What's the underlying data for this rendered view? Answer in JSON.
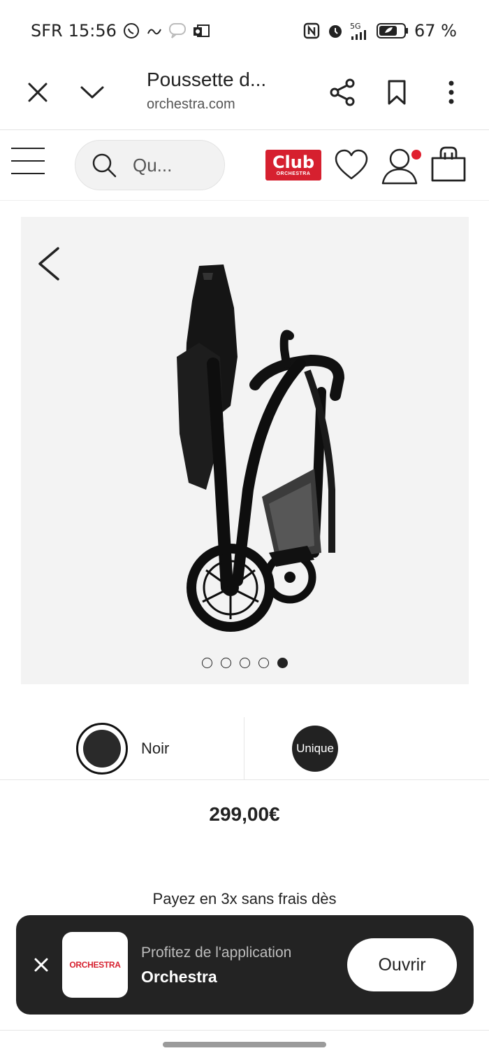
{
  "status_bar": {
    "carrier": "SFR",
    "time": "15:56",
    "battery": "67 %",
    "network": "5G",
    "left_icons": [
      "whatsapp-icon",
      "link-icon",
      "message-icon",
      "outlook-icon"
    ],
    "right_icons": [
      "nfc-icon",
      "alarm-icon",
      "signal-icon",
      "battery-icon"
    ]
  },
  "browser": {
    "tab_title": "Poussette d...",
    "url": "orchestra.com",
    "icons": [
      "close-icon",
      "chevron-down-icon",
      "share-icon",
      "bookmark-icon",
      "more-icon"
    ]
  },
  "site_header": {
    "search_placeholder": "Qu...",
    "club_label": "Club",
    "club_sub": "ORCHESTRA",
    "icons": [
      "menu-icon",
      "search-icon",
      "heart-icon",
      "account-icon",
      "bag-icon"
    ],
    "notification_color": "#e0202f"
  },
  "gallery": {
    "image_count": 5,
    "active_index": 4,
    "image": "folded-stroller"
  },
  "variants": {
    "color_label": "Noir",
    "color_value": "#2a2a2a",
    "size_label": "Unique"
  },
  "product": {
    "price": "299,00€",
    "installment_text": "Payez en 3x sans frais dès"
  },
  "app_banner": {
    "logo_text": "ORCHESTRA",
    "line1": "Profitez de l'application",
    "line2": "Orchestra",
    "open_label": "Ouvrir"
  },
  "colors": {
    "brand_red": "#d6202f",
    "banner_bg": "#232323",
    "gallery_bg": "#f3f3f3"
  }
}
